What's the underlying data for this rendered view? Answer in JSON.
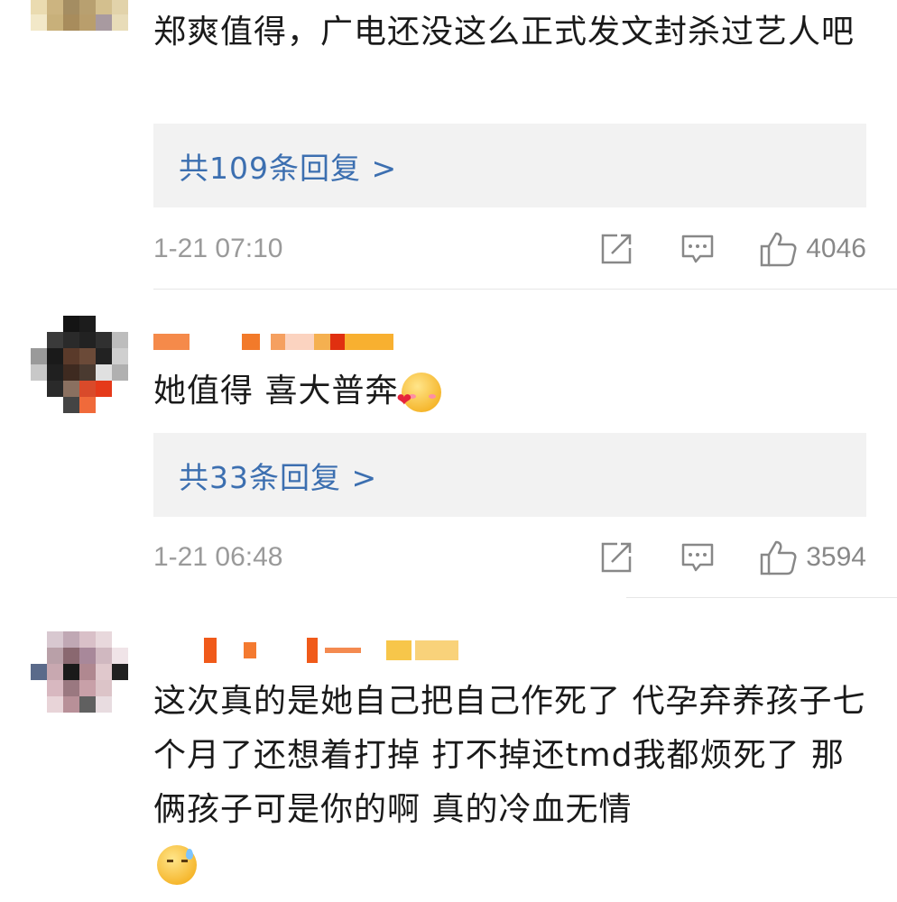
{
  "comments": [
    {
      "text": "郑爽值得，广电还没这么正式发文封杀过艺人吧",
      "replies_label": "共109条回复 >",
      "time": "1-21 07:10",
      "likes": "4046"
    },
    {
      "text": "她值得 喜大普奔",
      "replies_label": "共33条回复 >",
      "time": "1-21 06:48",
      "likes": "3594"
    },
    {
      "text": "这次真的是她自己把自己作死了 代孕弃养孩子七个月了还想着打掉 打不掉还tmd我都烦死了 那俩孩子可是你的啊 真的冷血无情"
    }
  ],
  "icons": {
    "share": "share-icon",
    "comment": "comment-icon",
    "like": "thumbs-up-icon",
    "emoji_1": "blush-heart-emoji",
    "emoji_2": "sweat-smile-emoji"
  },
  "colors": {
    "reply_link": "#3c6fb0",
    "reply_bg": "#f2f2f2",
    "meta_text": "#9a9a9a"
  }
}
